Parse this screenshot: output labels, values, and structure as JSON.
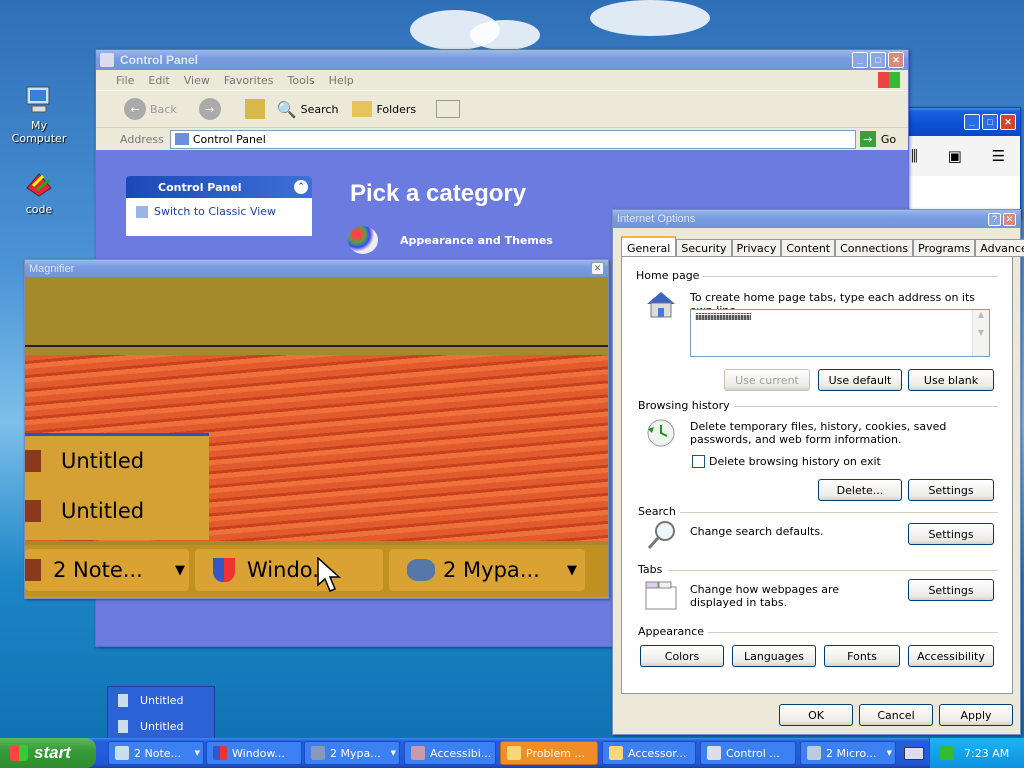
{
  "desktop": {
    "icons": [
      {
        "label": "My Computer"
      },
      {
        "label": "code"
      }
    ]
  },
  "control_panel": {
    "title": "Control Panel",
    "menu": [
      "File",
      "Edit",
      "View",
      "Favorites",
      "Tools",
      "Help"
    ],
    "toolbar": {
      "back": "Back",
      "search": "Search",
      "folders": "Folders"
    },
    "address_label": "Address",
    "address_value": "Control Panel",
    "go": "Go",
    "side_title": "Control Panel",
    "side_link": "Switch to Classic View",
    "heading": "Pick a category",
    "category": "Appearance and Themes"
  },
  "magnifier": {
    "title": "Magnifier",
    "items": [
      "Untitled",
      "Untitled"
    ],
    "tasks": [
      "2 Note...",
      "Windo...",
      "2 Mypa..."
    ]
  },
  "popup_menu": {
    "items": [
      "Untitled",
      "Untitled"
    ]
  },
  "internet_options": {
    "title": "Internet Options",
    "tabs": [
      "General",
      "Security",
      "Privacy",
      "Content",
      "Connections",
      "Programs",
      "Advanced"
    ],
    "home_page": {
      "label": "Home page",
      "desc": "To create home page tabs, type each address on its own line.",
      "value": "iiiiiiiiiiiiiiiiiiiiiiiiiiiiiiiiiiiii",
      "use_current": "Use current",
      "use_default": "Use default",
      "use_blank": "Use blank"
    },
    "browsing_history": {
      "label": "Browsing history",
      "desc": "Delete temporary files, history, cookies, saved passwords, and web form information.",
      "checkbox": "Delete browsing history on exit",
      "delete": "Delete...",
      "settings": "Settings"
    },
    "search": {
      "label": "Search",
      "desc": "Change search defaults.",
      "settings": "Settings"
    },
    "tabs_section": {
      "label": "Tabs",
      "desc": "Change how webpages are displayed in tabs.",
      "settings": "Settings"
    },
    "appearance": {
      "label": "Appearance",
      "buttons": [
        "Colors",
        "Languages",
        "Fonts",
        "Accessibility"
      ]
    },
    "ok": "OK",
    "cancel": "Cancel",
    "apply": "Apply"
  },
  "taskbar": {
    "start": "start",
    "tasks": [
      "2 Note...",
      "Window...",
      "2 Mypa...",
      "Accessibi...",
      "Problem ...",
      "Accessor...",
      "Control ...",
      "2 Micro..."
    ],
    "clock": "7:23 AM"
  },
  "colors": {
    "xp_blue": "#0c4fd6",
    "cp_sidebar": "#7a8ee6",
    "cp_heading": "#ffffff",
    "magnifier_orange": "#e2592a"
  }
}
